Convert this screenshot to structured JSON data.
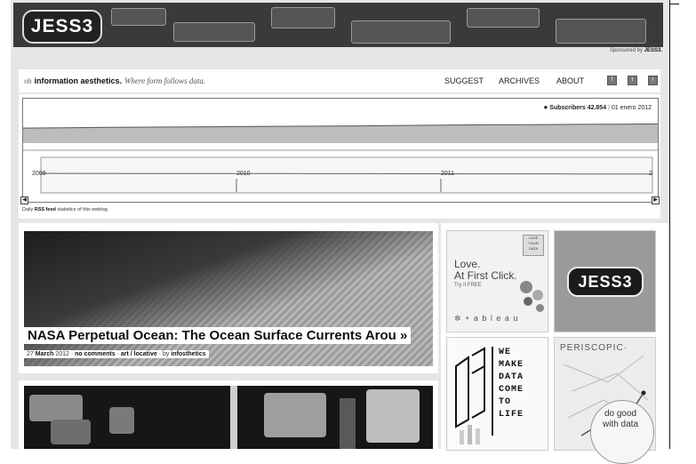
{
  "banner": {
    "logo": "JESS3",
    "sponsor_prefix": "Sponsored by",
    "sponsor_name": "JESS3."
  },
  "header": {
    "brand_name": "information aesthetics.",
    "tagline": "Where form follows data.",
    "nav": [
      "SUGGEST",
      "ARCHIVES",
      "ABOUT"
    ],
    "icons": [
      "facebook-icon",
      "twitter-icon",
      "rss-icon"
    ]
  },
  "chart_data": {
    "type": "line",
    "title": "",
    "series": [
      {
        "name": "Subscribers",
        "values": [
          41200,
          41350,
          41500,
          41600,
          41700,
          41800,
          41900,
          42000,
          42100,
          42250,
          42400,
          42500,
          42600,
          42700,
          42780,
          42854
        ]
      }
    ],
    "x": [
      "2009",
      "2009.25",
      "2009.5",
      "2009.75",
      "2010",
      "2010.25",
      "2010.5",
      "2010.75",
      "2011",
      "2011.25",
      "2011.5",
      "2011.75",
      "2011.9",
      "2012",
      "2012",
      "2012"
    ],
    "legend_text": "Subscribers 42.854",
    "legend_date": "01 enero 2012",
    "top_ticks": [
      "2009",
      "2010",
      "2011"
    ],
    "nav_ticks": [
      "2009",
      "2010",
      "2011",
      "2"
    ],
    "legend_position": "top-right",
    "grid": false
  },
  "credit": {
    "pre": "Daily",
    "link": "RSS feed",
    "post": "statistics of this weblog."
  },
  "featured": {
    "title": "NASA Perpetual Ocean: The Ocean Surface Currents Arou »",
    "date": "27",
    "month": "March",
    "year": "2012",
    "comments": "no comments",
    "category": "art / locative",
    "author_prefix": "by",
    "author": "infosthetics"
  },
  "sidebar": {
    "ad1": {
      "line1": "Love.",
      "line2": "At First Click.",
      "tryline": "Try it FREE",
      "brand": "+ a b l e a u",
      "tag": "LOVE YOUR DATA"
    },
    "ad2": {
      "logo": "JESS3"
    },
    "ad3": {
      "words": [
        "WE",
        "MAKE",
        "DATA",
        "COME",
        "TO",
        "LIFE"
      ]
    },
    "ad4": {
      "brand": "PERISCOPIC·",
      "line1": "do good",
      "line2": "with data"
    }
  }
}
